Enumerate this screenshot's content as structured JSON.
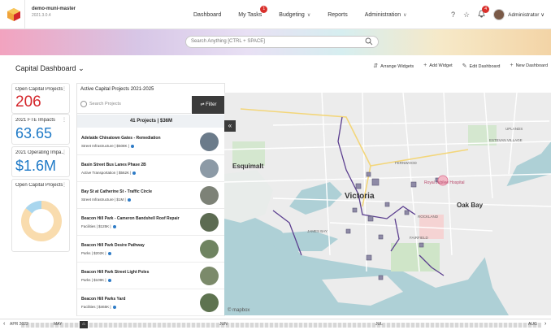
{
  "topnav": {
    "org_name": "demo-muni-master",
    "org_version": "2021.3.0.4",
    "links": [
      {
        "label": "Dashboard"
      },
      {
        "label": "My Tasks",
        "badge": "1"
      },
      {
        "label": "Budgeting",
        "chevron": "∨"
      },
      {
        "label": "Reports"
      },
      {
        "label": "Administration",
        "chevron": "∨"
      }
    ],
    "help_icon": "?",
    "star_icon": "☆",
    "bell_icon": "🔔",
    "notification_badge": "4",
    "user_label": "Administrator",
    "user_chevron": "∨"
  },
  "search": {
    "placeholder": "Search Anything [CTRL + SPACE]"
  },
  "toolbar": {
    "title": "Capital Dashboard",
    "title_chevron": "⌄",
    "actions": [
      {
        "icon": "⇵",
        "label": "Arrange Widgets"
      },
      {
        "icon": "+",
        "label": "Add Widget"
      },
      {
        "icon": "✎",
        "label": "Edit Dashboard"
      },
      {
        "icon": "+",
        "label": "New Dashboard"
      }
    ]
  },
  "kpis": [
    {
      "title": "Open Capital Projects",
      "value": "206",
      "color": "#d4262b"
    },
    {
      "title": "2021 FTE Impacts",
      "value": "63.65",
      "color": "#1f7ac7"
    },
    {
      "title": "2021 Operating Impa...",
      "value": "$1.6M",
      "color": "#1f7ac7"
    },
    {
      "title": "Open Capital Projects",
      "value": ""
    }
  ],
  "donut": {
    "fractions": [
      0.86,
      0.14
    ],
    "colors": [
      "#f9dcae",
      "#a9d6ee"
    ]
  },
  "projects": {
    "title": "Active Capital Projects 2021-2025",
    "search_placeholder": "Search Projects",
    "filter_label": "Filter",
    "filter_icon": "⇌",
    "summary": "41 Projects   |   $36M",
    "items": [
      {
        "title": "Adelaide Chinatown Gates - Remediation",
        "subtitle": "Street Infrastructure | $508K |",
        "thumb": "#6b7b8a"
      },
      {
        "title": "Basin Street Bus Lanes Phase 2B",
        "subtitle": "Active Transportation | $562K |",
        "thumb": "#8c9aa6"
      },
      {
        "title": "Bay St at Catherine St - Traffic Circle",
        "subtitle": "Street Infrastructure | $1M |",
        "thumb": "#7d8277"
      },
      {
        "title": "Beacon Hill Park - Cameron Bandshell Roof Repair",
        "subtitle": "Facilities | $125K |",
        "thumb": "#5c6b52"
      },
      {
        "title": "Beacon Hill Park Desire Pathway",
        "subtitle": "Parks | $202K |",
        "thumb": "#6f8461"
      },
      {
        "title": "Beacon Hill Park Street Light Poles",
        "subtitle": "Parks | $109K |",
        "thumb": "#7b8a6a"
      },
      {
        "title": "Beacon Hill Parks Yard",
        "subtitle": "Facilities | $465K |",
        "thumb": "#5e7350"
      }
    ]
  },
  "map": {
    "collapse_icon": "«",
    "labels": [
      {
        "text": "Esquimalt"
      },
      {
        "text": "Victoria"
      },
      {
        "text": "Oak Bay"
      },
      {
        "text": "Royal Jubilee Hospital"
      },
      {
        "text": "JAMES BAY"
      },
      {
        "text": "FAIRFIELD"
      },
      {
        "text": "ROCKLAND"
      },
      {
        "text": "UPLANDS"
      },
      {
        "text": "ESTEVAN VILLAGE"
      },
      {
        "text": "FERNWOOD"
      },
      {
        "text": "© mapbox"
      }
    ]
  },
  "timeline": {
    "left_arrow": "‹",
    "right_arrow": "›",
    "labels": [
      "APR 2022",
      "MAY",
      "JUN",
      "JUL",
      "AUG"
    ]
  }
}
